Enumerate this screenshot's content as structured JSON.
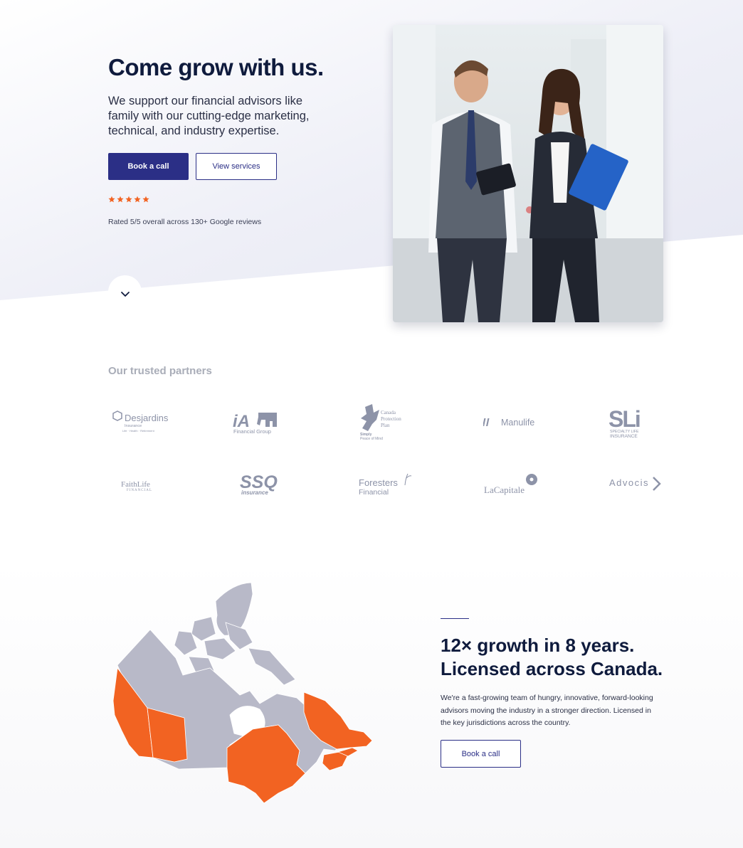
{
  "hero": {
    "title": "Come grow with us.",
    "subtitle": "We support our financial advisors like family with our cutting-edge marketing, technical, and industry expertise.",
    "primary_button": "Book a call",
    "secondary_button": "View services",
    "rating": 5,
    "rating_max": 5,
    "rating_text": "Rated 5/5 overall across 130+ Google reviews",
    "scroll_icon": "chevron-down-icon"
  },
  "partners": {
    "title": "Our trusted partners",
    "logos": [
      {
        "name": "Desjardins",
        "line2": "Insurance",
        "line3": "Life · Health · Retirement"
      },
      {
        "name": "iA",
        "line2": "Financial Group"
      },
      {
        "name": "Canada",
        "line2": "Protection",
        "line3": "Plan",
        "line4": "Simply",
        "line5": "Peace of Mind"
      },
      {
        "name": "Manulife"
      },
      {
        "name": "SLi",
        "line2": "SPECIALTY LIFE",
        "line3": "INSURANCE"
      },
      {
        "name": "FaithLife",
        "line2": "FINANCIAL"
      },
      {
        "name": "SSQ",
        "line2": "insurance"
      },
      {
        "name": "Foresters",
        "line2": "Financial"
      },
      {
        "name": "LaCapitale"
      },
      {
        "name": "Advocis"
      }
    ]
  },
  "growth": {
    "title_line1": "12× growth in 8 years.",
    "title_line2": "Licensed across Canada.",
    "text": "We're a fast-growing team of hungry, innovative, forward-looking advisors moving the industry in a stronger direction. Licensed in the key jurisdictions across the country.",
    "button": "Book a call"
  },
  "colors": {
    "brand": "#2b2f86",
    "accent": "#f26322",
    "map_grey": "#b8b9c8",
    "heading": "#0f1b3d"
  }
}
